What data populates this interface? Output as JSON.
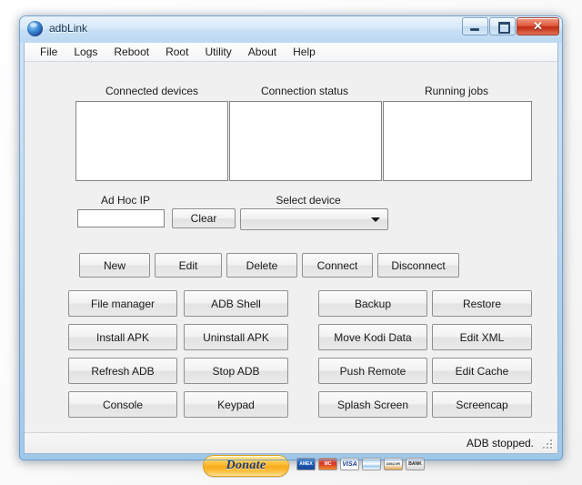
{
  "window": {
    "title": "adbLink",
    "icon": "app-orb-icon",
    "caption": {
      "minimize": "minimize-icon",
      "maximize": "maximize-icon",
      "close_label": "✕"
    }
  },
  "menubar": {
    "items": [
      {
        "label": "File"
      },
      {
        "label": "Logs"
      },
      {
        "label": "Reboot"
      },
      {
        "label": "Root"
      },
      {
        "label": "Utility"
      },
      {
        "label": "About"
      },
      {
        "label": "Help"
      }
    ]
  },
  "panels": [
    {
      "label": "Connected devices",
      "items": []
    },
    {
      "label": "Connection status",
      "items": []
    },
    {
      "label": "Running jobs",
      "items": []
    }
  ],
  "adhoc": {
    "label": "Ad Hoc IP",
    "value": "",
    "placeholder": "",
    "clear_label": "Clear"
  },
  "select_device": {
    "label": "Select device",
    "selected": "",
    "options": []
  },
  "device_actions": [
    {
      "label": "New"
    },
    {
      "label": "Edit"
    },
    {
      "label": "Delete"
    },
    {
      "label": "Connect"
    },
    {
      "label": "Disconnect"
    }
  ],
  "tools_left": [
    {
      "label": "File manager"
    },
    {
      "label": "Install APK"
    },
    {
      "label": "Refresh ADB"
    },
    {
      "label": "Console"
    },
    {
      "label": "ADB Shell"
    },
    {
      "label": "Uninstall APK"
    },
    {
      "label": "Stop ADB"
    },
    {
      "label": "Keypad"
    }
  ],
  "tools_right": [
    {
      "label": "Backup"
    },
    {
      "label": "Move Kodi Data"
    },
    {
      "label": "Push Remote"
    },
    {
      "label": "Splash Screen"
    },
    {
      "label": "Restore"
    },
    {
      "label": "Edit XML"
    },
    {
      "label": "Edit Cache"
    },
    {
      "label": "Screencap"
    }
  ],
  "donate": {
    "label": "Donate",
    "cards": [
      {
        "name": "amex-card-icon",
        "text": "AMEX"
      },
      {
        "name": "mastercard-card-icon",
        "text": "MC"
      },
      {
        "name": "visa-card-icon",
        "text": "VISA"
      },
      {
        "name": "echeck-card-icon",
        "text": ""
      },
      {
        "name": "discover-card-icon",
        "text": "DISCVR"
      },
      {
        "name": "bank-card-icon",
        "text": "BANK"
      }
    ]
  },
  "statusbar": {
    "text": "ADB stopped."
  },
  "colors": {
    "client_bg": "#f0f0f0",
    "frame": "#9ec8ea",
    "close_button": "#c02c12",
    "donate_accent": "#f8ab1c"
  }
}
